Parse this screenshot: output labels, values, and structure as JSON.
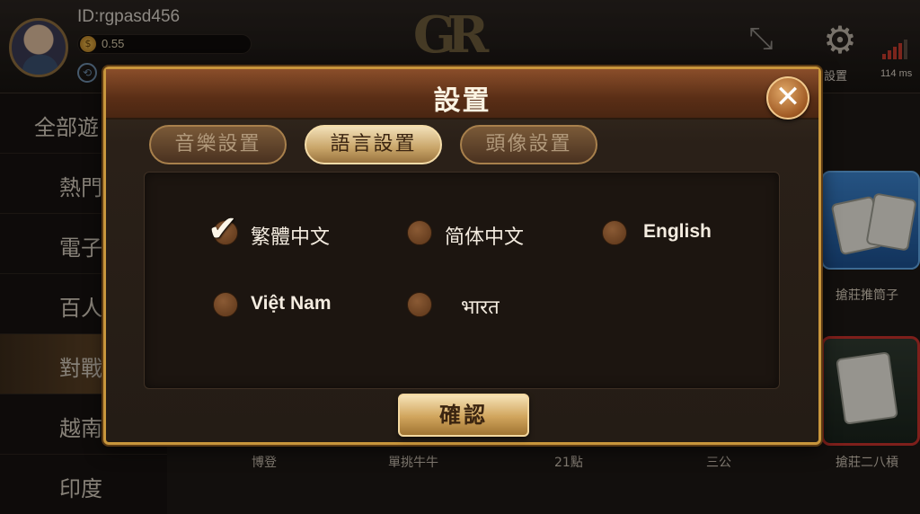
{
  "header": {
    "user_id": "ID:rgpasd456",
    "balance": "0.55",
    "settings_label": "設置",
    "ping": "114 ms"
  },
  "sidebar": {
    "items": [
      {
        "label": "全部遊"
      },
      {
        "label": "熱門"
      },
      {
        "label": "電子"
      },
      {
        "label": "百人"
      },
      {
        "label": "對戰"
      },
      {
        "label": "越南"
      },
      {
        "label": "印度"
      }
    ]
  },
  "games": {
    "captions": [
      "博登",
      "單挑牛牛",
      "21點",
      "三公",
      "搶莊二八槓"
    ],
    "tile_captions": [
      "搶莊推筒子"
    ]
  },
  "modal": {
    "title": "設置",
    "tabs": [
      {
        "label": "音樂設置",
        "active": false
      },
      {
        "label": "語言設置",
        "active": true
      },
      {
        "label": "頭像設置",
        "active": false
      }
    ],
    "languages": [
      {
        "label": "繁體中文",
        "selected": true
      },
      {
        "label": "简体中文",
        "selected": false
      },
      {
        "label": "English",
        "selected": false
      },
      {
        "label": "Việt Nam",
        "selected": false
      },
      {
        "label": "भारत",
        "selected": false
      }
    ],
    "confirm_label": "確認"
  },
  "colors": {
    "accent_gold": "#c8963c",
    "header_brown": "#5a2e16"
  }
}
